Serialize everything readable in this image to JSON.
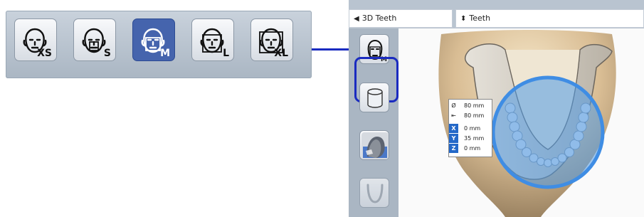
{
  "zoom_strip": {
    "selected": "M",
    "options": [
      {
        "label": "XS",
        "icon": "head-xs-icon"
      },
      {
        "label": "S",
        "icon": "head-s-icon"
      },
      {
        "label": "M",
        "icon": "head-m-icon"
      },
      {
        "label": "L",
        "icon": "head-l-icon"
      },
      {
        "label": "XL",
        "icon": "head-xl-icon"
      }
    ]
  },
  "topbar": {
    "back_label": "3D Teeth",
    "select_label": "Teeth"
  },
  "tools": {
    "fov_size_label": "M",
    "items": [
      "head-size-icon",
      "cylinder-icon",
      "patient-head-icon",
      "jaw-arch-icon"
    ]
  },
  "info_panel": {
    "diameter": "80 mm",
    "height": "80 mm",
    "x_key": "X",
    "x": "0 mm",
    "y_key": "Y",
    "y": "35 mm",
    "z_key": "Z",
    "z": "0 mm"
  },
  "colors": {
    "accent": "#1a2bc0",
    "selected_button": "#4564ad",
    "fov_circle": "#4f9be8"
  }
}
